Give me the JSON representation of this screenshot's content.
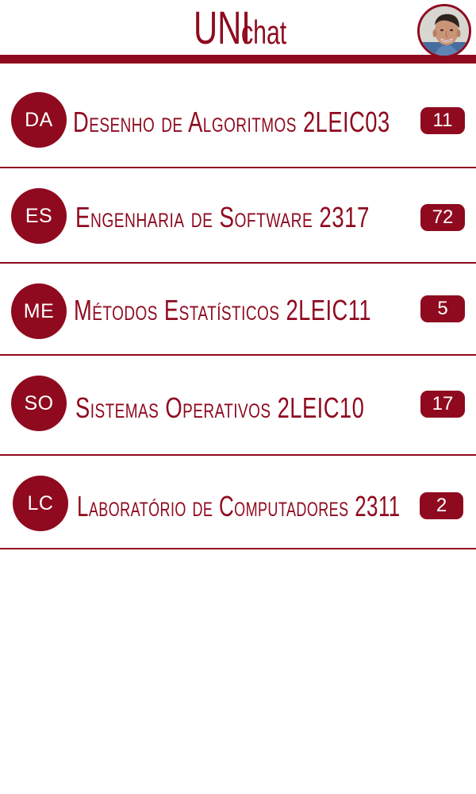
{
  "app": {
    "title_main": "UNI",
    "title_sub": "chat"
  },
  "chats": [
    {
      "initials": "DA",
      "label": "Desenho de Algoritmos 2LEIC03",
      "count": "11"
    },
    {
      "initials": "ES",
      "label": "Engenharia de Software 2317",
      "count": "72"
    },
    {
      "initials": "ME",
      "label": "Métodos Estatísticos 2LEIC11",
      "count": "5"
    },
    {
      "initials": "SO",
      "label": "Sistemas Operativos 2LEIC10",
      "count": "17"
    },
    {
      "initials": "LC",
      "label": "Laboratório de Computadores 2311",
      "count": "2"
    }
  ],
  "colors": {
    "accent": "#8f0a1f",
    "background": "#ffffff"
  }
}
